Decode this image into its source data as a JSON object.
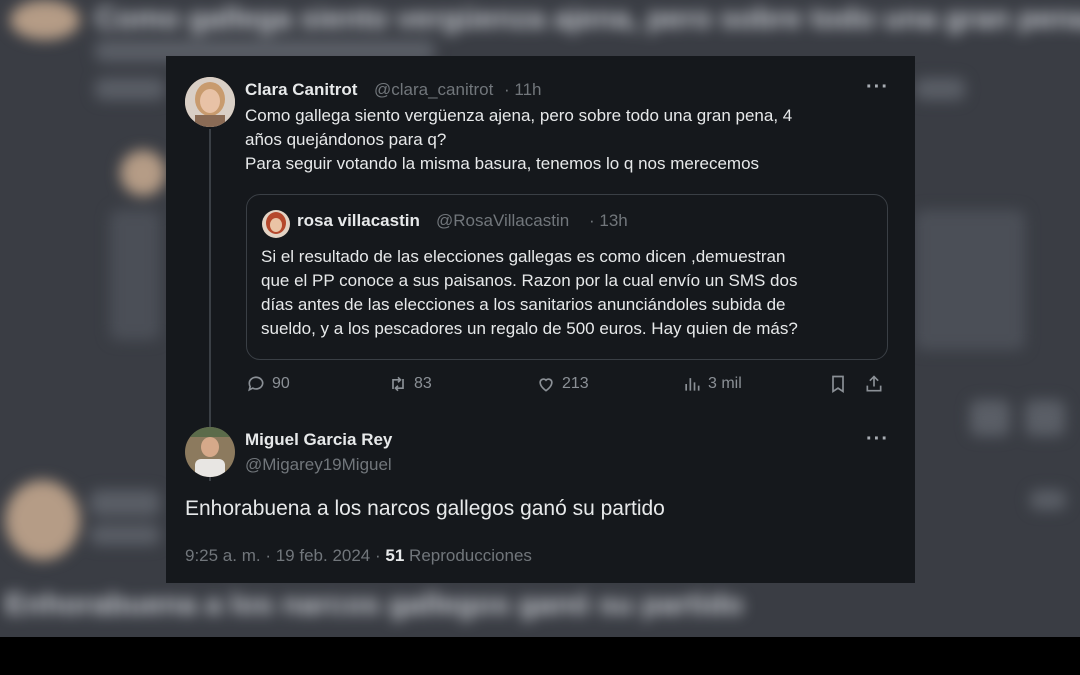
{
  "tweet": {
    "author_name": "Clara Canitrot",
    "handle": "@clara_canitrot",
    "time": "· 11h",
    "text_lines": [
      "Como gallega siento vergüenza ajena, pero sobre todo una gran pena, 4",
      "años quejándonos para q?",
      "Para seguir votando la misma basura, tenemos lo q nos merecemos"
    ],
    "more_icon": "more-horizontal-icon"
  },
  "quote": {
    "author_name": "rosa villacastin",
    "handle": "@RosaVillacastin",
    "time": "· 13h",
    "text_lines": [
      "Si el resultado de las elecciones gallegas es como dicen ,demuestran",
      "que el PP conoce a sus paisanos. Razon por la cual envío un SMS dos",
      "días antes de las elecciones a los sanitarios anunciándoles subida de",
      "sueldo, y a los pescadores un regalo de 500 euros. Hay quien de más?"
    ]
  },
  "actions": {
    "replies": "90",
    "retweets": "83",
    "likes": "213",
    "views": "3 mil"
  },
  "reply": {
    "author_name": "Miguel Garcia Rey",
    "handle": "@Migarey19Miguel",
    "text": "Enhorabuena a los narcos gallegos ganó su partido",
    "time": "9:25 a. m.",
    "date": "· 19 feb. 2024 ·",
    "views_count": "51",
    "views_label": "Reproducciones"
  },
  "background": {
    "text_top": "Como gallega siento vergüenza ajena, pero sobre todo una gran pena, 4",
    "text_bottom": "Enhorabuena a los narcos gallegos ganó su partido"
  }
}
